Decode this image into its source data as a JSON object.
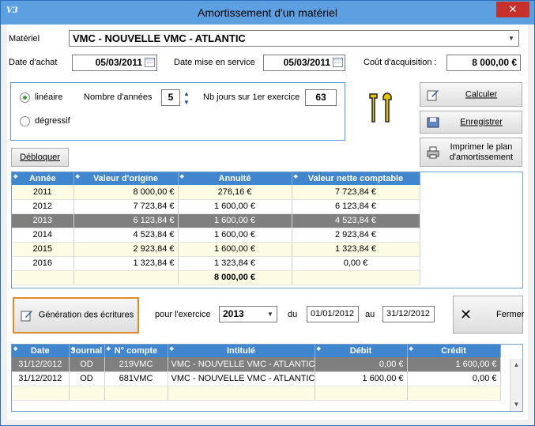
{
  "window": {
    "title": "Amortissement d'un matériel",
    "app_icon": "V3",
    "close_glyph": "✕"
  },
  "materiel": {
    "label": "Matériel",
    "value": "VMC - NOUVELLE VMC - ATLANTIC"
  },
  "achat": {
    "label": "Date d'achat",
    "value": "05/03/2011"
  },
  "service": {
    "label": "Date mise en service",
    "value": "05/03/2011"
  },
  "cout": {
    "label": "Coût d'acquisition :",
    "value": "8 000,00 €"
  },
  "options": {
    "lineaire": "linéaire",
    "degressif": "dégressif",
    "selected": "linéaire",
    "annees_label": "Nombre d'années",
    "annees_value": "5",
    "jours_label": "Nb jours sur 1er exercice",
    "jours_value": "63"
  },
  "buttons": {
    "calculer": "Calculer",
    "enregistrer": "Enregistrer",
    "imprimer": "Imprimer le plan d'amortissement",
    "debloquer": "Débloquer",
    "generation": "Génération des écritures",
    "fermer": "Fermer"
  },
  "plan": {
    "columns": [
      "Année",
      "Valeur d'origine",
      "Annuité",
      "Valeur nette comptable"
    ],
    "rows": [
      [
        "2011",
        "8 000,00 €",
        "276,16 €",
        "7 723,84 €"
      ],
      [
        "2012",
        "7 723,84 €",
        "1 600,00 €",
        "6 123,84 €"
      ],
      [
        "2013",
        "6 123,84 €",
        "1 600,00 €",
        "4 523,84 €"
      ],
      [
        "2014",
        "4 523,84 €",
        "1 600,00 €",
        "2 923,84 €"
      ],
      [
        "2015",
        "2 923,84 €",
        "1 600,00 €",
        "1 323,84 €"
      ],
      [
        "2016",
        "1 323,84 €",
        "1 323,84 €",
        "0,00 €"
      ]
    ],
    "selected_row": 2,
    "total": "8 000,00 €"
  },
  "exercice": {
    "label": "pour l'exercice",
    "value": "2013",
    "du_label": "du",
    "du_value": "01/01/2012",
    "au_label": "au",
    "au_value": "31/12/2012"
  },
  "ecritures": {
    "columns": [
      "Date",
      "Journal",
      "N° compte",
      "Intitulé",
      "Débit",
      "Crédit"
    ],
    "rows": [
      [
        "31/12/2012",
        "OD",
        "219VMC",
        "VMC - NOUVELLE VMC - ATLANTIC",
        "0,00 €",
        "1 600,00 €"
      ],
      [
        "31/12/2012",
        "OD",
        "681VMC",
        "VMC - NOUVELLE VMC - ATLANTIC",
        "1 600,00 €",
        "0,00 €"
      ]
    ],
    "selected_row": 0
  },
  "colors": {
    "title_bar": "#5da0e2",
    "grid_header": "#3f86ce",
    "row_alt": "#fdfbe3",
    "row_selected": "#7f7f7f",
    "close": "#c7312b"
  }
}
